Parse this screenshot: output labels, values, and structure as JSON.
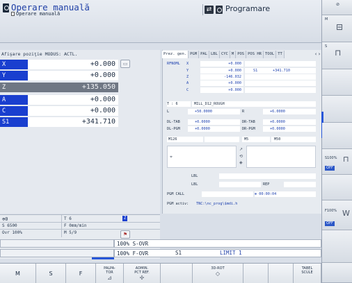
{
  "header": {
    "mode_title": "Operare manuală",
    "mode_subtitle": "Operare manuală",
    "prog_title": "Programare"
  },
  "position_panel": {
    "heading": "Afişare poziţie MODUS: ACTL.",
    "axes": [
      {
        "name": "X",
        "value": "+0.000",
        "style": "blue"
      },
      {
        "name": "Y",
        "value": "+0.000",
        "style": "blue"
      },
      {
        "name": "Z",
        "value": "+135.050",
        "style": "gray"
      },
      {
        "name": "A",
        "value": "+0.000",
        "style": "blue"
      },
      {
        "name": "C",
        "value": "+0.000",
        "style": "blue"
      },
      {
        "name": "S1",
        "value": "+341.710",
        "style": "blue"
      }
    ]
  },
  "status": {
    "tool_icon_label": "0",
    "t_value": "T 6",
    "z_badge": "Z",
    "s_value": "S 6500",
    "f_value": "F 0mm/min",
    "ovr_value": "Ovr 100%",
    "m_value": "M 5/9"
  },
  "tabs": [
    "Prez. gen.",
    "PGM",
    "PAL",
    "LBL",
    "CYC",
    "M",
    "POS",
    "POS HR",
    "TOOL",
    "TT"
  ],
  "tab_arrows": "‹ ›",
  "overview": {
    "rfnoml": "RFNOML",
    "rows": [
      {
        "axis": "X",
        "value": "+0.000"
      },
      {
        "axis": "Y",
        "value": "+0.000",
        "extra_label": "S1",
        "extra_value": "+341.710"
      },
      {
        "axis": "Z",
        "value": "-146.032"
      },
      {
        "axis": "A",
        "value": "+0.000"
      },
      {
        "axis": "C",
        "value": "+0.000"
      }
    ],
    "tool_t": "T : 6",
    "tool_name": "MILL_D12_ROUGH",
    "l_label": "L",
    "l_value": "+50.0000",
    "r_label": "R",
    "r_value": "+6.0000",
    "dltab_label": "DL-TAB",
    "dltab_value": "+0.0000",
    "drtab_label": "DR-TAB",
    "drtab_value": "+0.0000",
    "dlpgm_label": "DL-PGM",
    "dlpgm_value": "+0.0000",
    "drpgm_label": "DR-PGM",
    "drpgm_value": "+0.0000",
    "m126": "M126",
    "m5": "M5",
    "m50": "M50",
    "lbl1": "LBL",
    "lbl2": "LBL",
    "rep": "REP",
    "pgm_call": "PGM CALL",
    "timer": "00:00:04",
    "pgm_active_label": "PGM activ:",
    "pgm_active_value": "TNC:\\nc_prog\\$mdi.h"
  },
  "override_bars": {
    "s_ovr": "100% S-OVR",
    "f_ovr": "100% F-OVR",
    "s1_label": "S1",
    "limit": "LIMIT 1"
  },
  "softkeys": [
    {
      "label": "M"
    },
    {
      "label": "S"
    },
    {
      "label": "F"
    },
    {
      "label": "PALPA-\nTOR"
    },
    {
      "label": "ADMIN.\nPCT REF."
    },
    {
      "label": ""
    },
    {
      "label": "3D-ROT"
    },
    {
      "label": ""
    },
    {
      "label": ""
    },
    {
      "label": "TABEL\nSCULE"
    }
  ],
  "side_softkeys": {
    "m_label": "M",
    "s_label": "S",
    "s_override": "S100%",
    "f_override": "F100%",
    "off1": "OFF",
    "off2": "OFF"
  },
  "colors": {
    "accent": "#1a3fcf",
    "mode_title": "#1f3fa6",
    "panel": "#e5e9ef"
  }
}
